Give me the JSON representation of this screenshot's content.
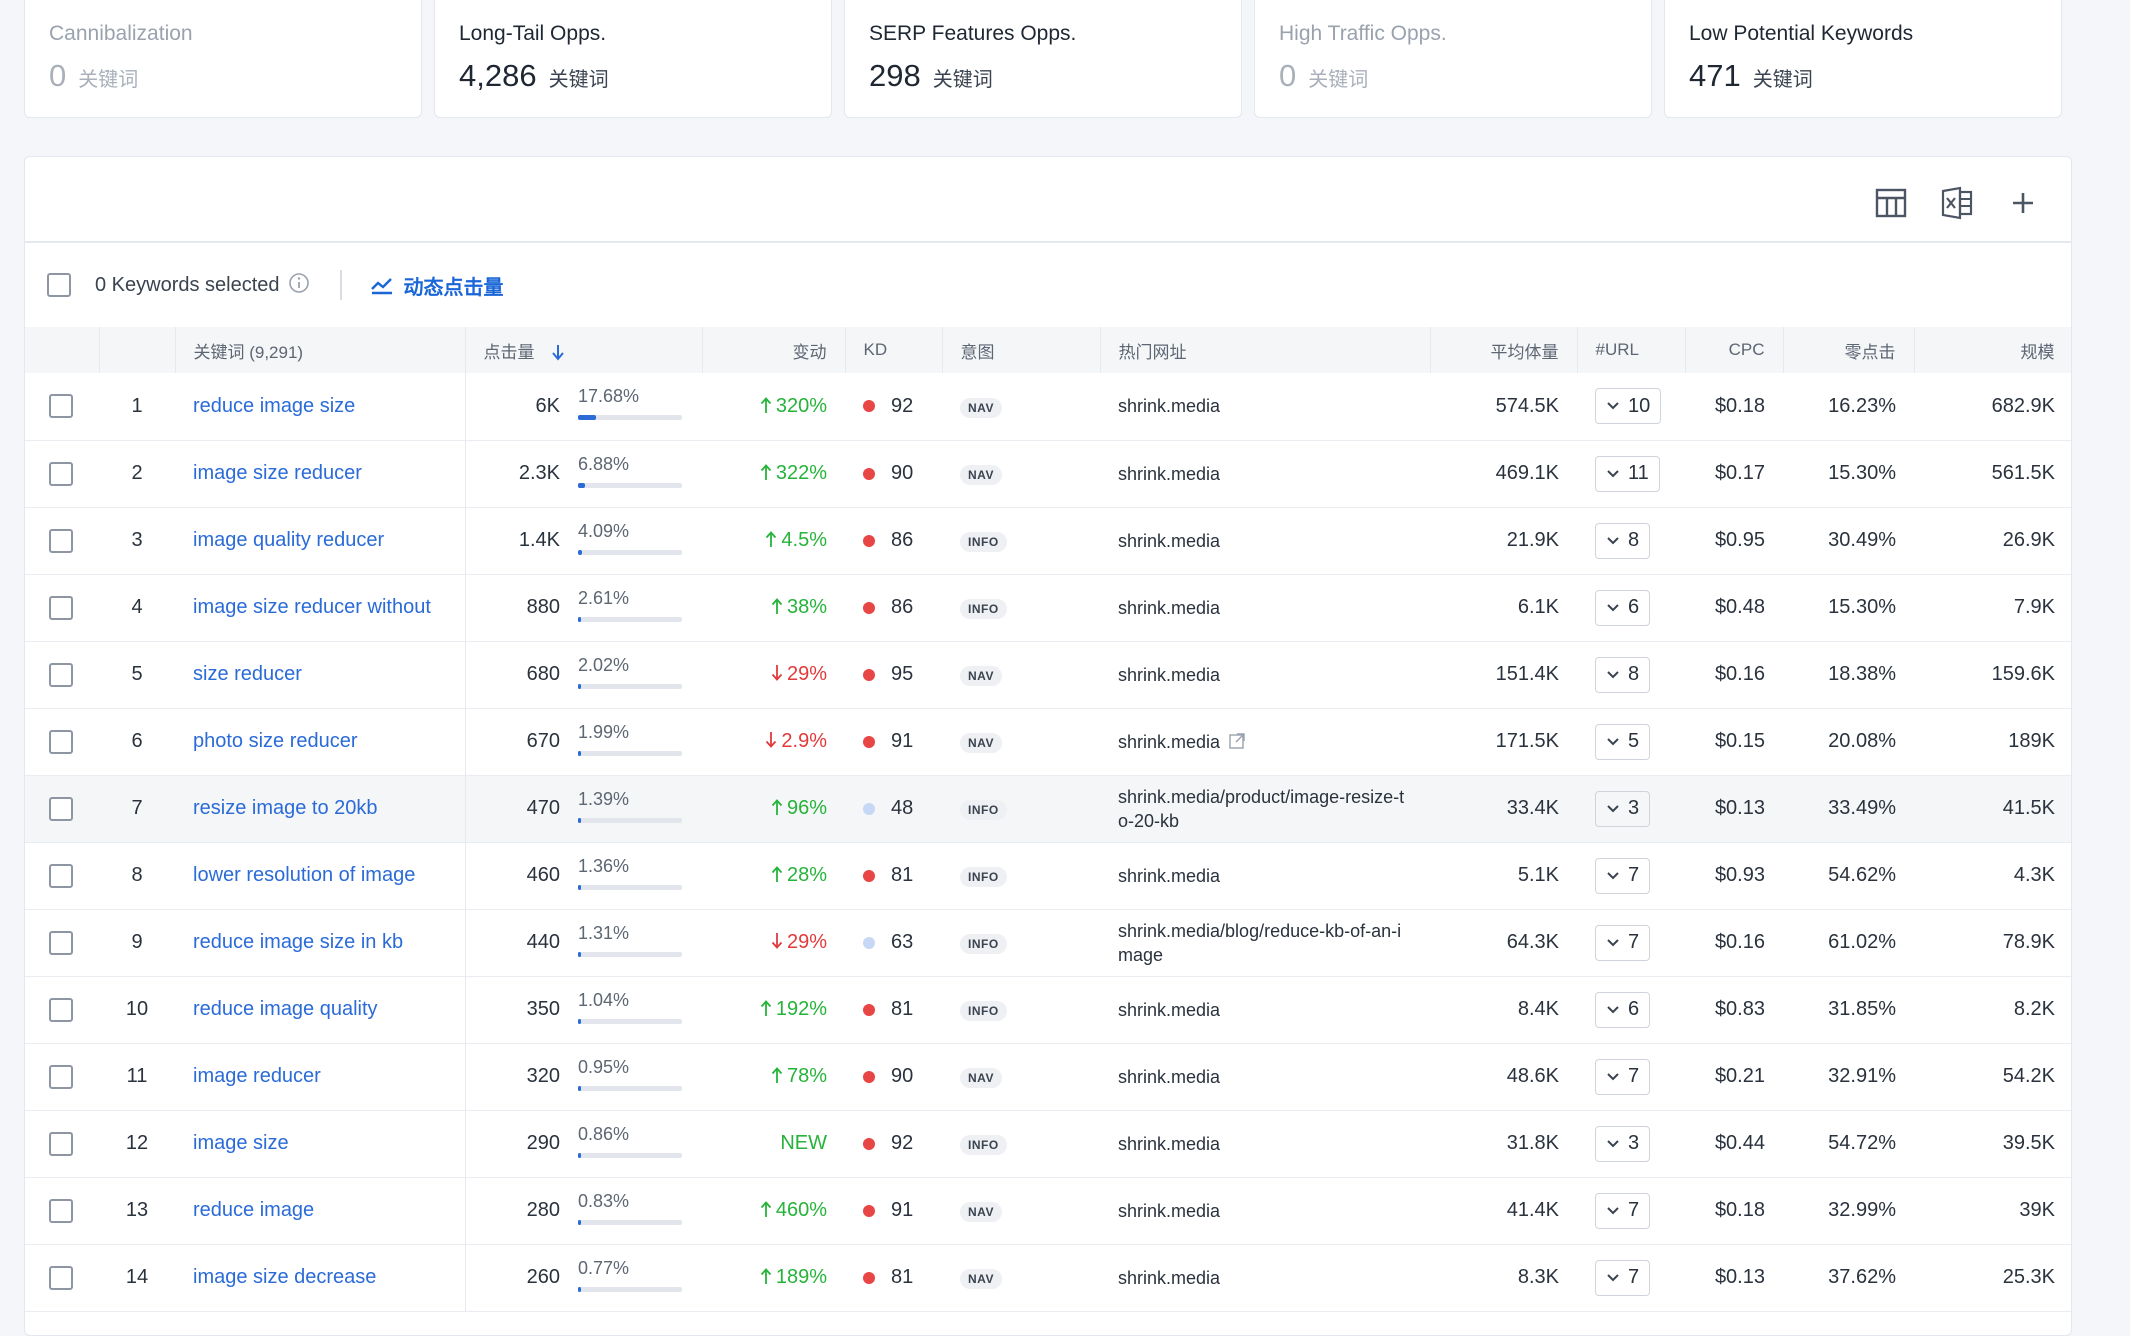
{
  "cards": [
    {
      "title": "Cannibalization",
      "value": "0",
      "unit": "关键词",
      "muted": true
    },
    {
      "title": "Long-Tail Opps.",
      "value": "4,286",
      "unit": "关键词",
      "muted": false
    },
    {
      "title": "SERP Features Opps.",
      "value": "298",
      "unit": "关键词",
      "muted": false
    },
    {
      "title": "High Traffic Opps.",
      "value": "0",
      "unit": "关键词",
      "muted": true
    },
    {
      "title": "Low Potential Keywords",
      "value": "471",
      "unit": "关键词",
      "muted": false
    }
  ],
  "toolbar": {
    "icons": [
      "table-columns-icon",
      "excel-export-icon",
      "plus-icon"
    ]
  },
  "selection": {
    "text": "0 Keywords selected",
    "trend_label": "动态点击量"
  },
  "colors": {
    "accent": "#2a6bd8",
    "up": "#26b33a",
    "down": "#e23a3a",
    "kd_hard": "#e84545",
    "kd_medium": "#c6d8f5"
  },
  "table": {
    "headers": {
      "keyword": "关键词 (9,291)",
      "clicks": "点击量",
      "change": "变动",
      "kd": "KD",
      "intent": "意图",
      "url": "热门网址",
      "volume": "平均体量",
      "urls": "#URL",
      "cpc": "CPC",
      "zero_click": "零点击",
      "scale": "规模"
    },
    "rows": [
      {
        "idx": "1",
        "keyword": "reduce image size",
        "clicks": "6K",
        "share": "17.68%",
        "share_value": 0.1768,
        "change": "320%",
        "dir": "up",
        "kd": "92",
        "kd_color": "#e84545",
        "intent": "NAV",
        "url": "shrink.media",
        "volume": "574.5K",
        "urls": "10",
        "cpc": "$0.18",
        "zero": "16.23%",
        "scale": "682.9K"
      },
      {
        "idx": "2",
        "keyword": "image size reducer",
        "clicks": "2.3K",
        "share": "6.88%",
        "share_value": 0.0688,
        "change": "322%",
        "dir": "up",
        "kd": "90",
        "kd_color": "#e84545",
        "intent": "NAV",
        "url": "shrink.media",
        "volume": "469.1K",
        "urls": "11",
        "cpc": "$0.17",
        "zero": "15.30%",
        "scale": "561.5K"
      },
      {
        "idx": "3",
        "keyword": "image quality reducer",
        "clicks": "1.4K",
        "share": "4.09%",
        "share_value": 0.0409,
        "change": "4.5%",
        "dir": "up",
        "kd": "86",
        "kd_color": "#e84545",
        "intent": "INFO",
        "url": "shrink.media",
        "volume": "21.9K",
        "urls": "8",
        "cpc": "$0.95",
        "zero": "30.49%",
        "scale": "26.9K"
      },
      {
        "idx": "4",
        "keyword": "image size reducer without",
        "clicks": "880",
        "share": "2.61%",
        "share_value": 0.0261,
        "change": "38%",
        "dir": "up",
        "kd": "86",
        "kd_color": "#e84545",
        "intent": "INFO",
        "url": "shrink.media",
        "volume": "6.1K",
        "urls": "6",
        "cpc": "$0.48",
        "zero": "15.30%",
        "scale": "7.9K"
      },
      {
        "idx": "5",
        "keyword": "size reducer",
        "clicks": "680",
        "share": "2.02%",
        "share_value": 0.0202,
        "change": "29%",
        "dir": "down",
        "kd": "95",
        "kd_color": "#e84545",
        "intent": "NAV",
        "url": "shrink.media",
        "volume": "151.4K",
        "urls": "8",
        "cpc": "$0.16",
        "zero": "18.38%",
        "scale": "159.6K"
      },
      {
        "idx": "6",
        "keyword": "photo size reducer",
        "clicks": "670",
        "share": "1.99%",
        "share_value": 0.0199,
        "change": "2.9%",
        "dir": "down",
        "kd": "91",
        "kd_color": "#e84545",
        "intent": "NAV",
        "url": "shrink.media",
        "ext": true,
        "volume": "171.5K",
        "urls": "5",
        "cpc": "$0.15",
        "zero": "20.08%",
        "scale": "189K"
      },
      {
        "idx": "7",
        "keyword": "resize image to 20kb",
        "clicks": "470",
        "share": "1.39%",
        "share_value": 0.0139,
        "change": "96%",
        "dir": "up",
        "kd": "48",
        "kd_color": "#c6d8f5",
        "intent": "INFO",
        "url": "shrink.media/product/image-resize-to-20-kb",
        "volume": "33.4K",
        "urls": "3",
        "cpc": "$0.13",
        "zero": "33.49%",
        "scale": "41.5K",
        "highlight": true
      },
      {
        "idx": "8",
        "keyword": "lower resolution of image",
        "clicks": "460",
        "share": "1.36%",
        "share_value": 0.0136,
        "change": "28%",
        "dir": "up",
        "kd": "81",
        "kd_color": "#e84545",
        "intent": "INFO",
        "url": "shrink.media",
        "volume": "5.1K",
        "urls": "7",
        "cpc": "$0.93",
        "zero": "54.62%",
        "scale": "4.3K"
      },
      {
        "idx": "9",
        "keyword": "reduce image size in kb",
        "clicks": "440",
        "share": "1.31%",
        "share_value": 0.0131,
        "change": "29%",
        "dir": "down",
        "kd": "63",
        "kd_color": "#c6d8f5",
        "intent": "INFO",
        "url": "shrink.media/blog/reduce-kb-of-an-image",
        "volume": "64.3K",
        "urls": "7",
        "cpc": "$0.16",
        "zero": "61.02%",
        "scale": "78.9K"
      },
      {
        "idx": "10",
        "keyword": "reduce image quality",
        "clicks": "350",
        "share": "1.04%",
        "share_value": 0.0104,
        "change": "192%",
        "dir": "up",
        "kd": "81",
        "kd_color": "#e84545",
        "intent": "INFO",
        "url": "shrink.media",
        "volume": "8.4K",
        "urls": "6",
        "cpc": "$0.83",
        "zero": "31.85%",
        "scale": "8.2K"
      },
      {
        "idx": "11",
        "keyword": "image reducer",
        "clicks": "320",
        "share": "0.95%",
        "share_value": 0.0095,
        "change": "78%",
        "dir": "up",
        "kd": "90",
        "kd_color": "#e84545",
        "intent": "NAV",
        "url": "shrink.media",
        "volume": "48.6K",
        "urls": "7",
        "cpc": "$0.21",
        "zero": "32.91%",
        "scale": "54.2K"
      },
      {
        "idx": "12",
        "keyword": "image size",
        "clicks": "290",
        "share": "0.86%",
        "share_value": 0.0086,
        "change": "NEW",
        "dir": "new",
        "kd": "92",
        "kd_color": "#e84545",
        "intent": "INFO",
        "url": "shrink.media",
        "volume": "31.8K",
        "urls": "3",
        "cpc": "$0.44",
        "zero": "54.72%",
        "scale": "39.5K"
      },
      {
        "idx": "13",
        "keyword": "reduce image",
        "clicks": "280",
        "share": "0.83%",
        "share_value": 0.0083,
        "change": "460%",
        "dir": "up",
        "kd": "91",
        "kd_color": "#e84545",
        "intent": "NAV",
        "url": "shrink.media",
        "volume": "41.4K",
        "urls": "7",
        "cpc": "$0.18",
        "zero": "32.99%",
        "scale": "39K"
      },
      {
        "idx": "14",
        "keyword": "image size decrease",
        "clicks": "260",
        "share": "0.77%",
        "share_value": 0.0077,
        "change": "189%",
        "dir": "up",
        "kd": "81",
        "kd_color": "#e84545",
        "intent": "NAV",
        "url": "shrink.media",
        "volume": "8.3K",
        "urls": "7",
        "cpc": "$0.13",
        "zero": "37.62%",
        "scale": "25.3K"
      }
    ]
  }
}
